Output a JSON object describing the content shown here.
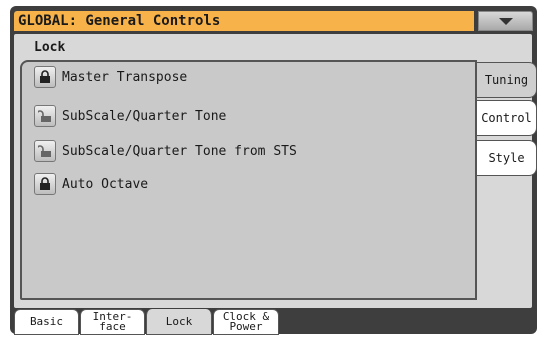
{
  "title": "GLOBAL: General Controls",
  "section_label": "Lock",
  "lock_items": [
    {
      "label": "Master Transpose",
      "state": "locked"
    },
    {
      "label": "SubScale/Quarter Tone",
      "state": "unlocked"
    },
    {
      "label": "SubScale/Quarter Tone from STS",
      "state": "unlocked"
    },
    {
      "label": "Auto Octave",
      "state": "locked"
    }
  ],
  "side_tabs": [
    {
      "label": "Tuning",
      "selected": false
    },
    {
      "label": "Control",
      "selected": true
    },
    {
      "label": "Style",
      "selected": false
    }
  ],
  "bottom_tabs": [
    {
      "label": "Basic",
      "selected": false
    },
    {
      "label_line1": "Inter-",
      "label_line2": "face",
      "selected": false
    },
    {
      "label": "Lock",
      "selected": true
    },
    {
      "label_line1": "Clock &",
      "label_line2": "Power",
      "selected": false
    }
  ],
  "colors": {
    "title_bar": "#f7b24a",
    "frame": "#3e3e3e",
    "panel": "#d8d8d8"
  },
  "icons": {
    "menu": "chevron-down-icon",
    "locked": "lock-closed-icon",
    "unlocked": "lock-open-icon"
  }
}
